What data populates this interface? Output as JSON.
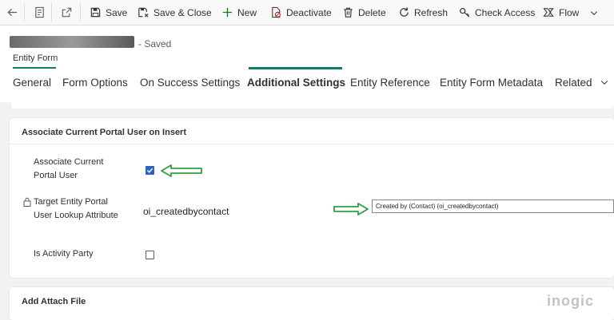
{
  "toolbar": {
    "save": "Save",
    "save_close": "Save & Close",
    "new": "New",
    "deactivate": "Deactivate",
    "delete": "Delete",
    "refresh": "Refresh",
    "check_access": "Check Access",
    "flow": "Flow"
  },
  "header": {
    "status": "- Saved",
    "entity_type": "Entity Form"
  },
  "tabs": [
    {
      "label": "General"
    },
    {
      "label": "Form Options"
    },
    {
      "label": "On Success Settings"
    },
    {
      "label": "Additional Settings"
    },
    {
      "label": "Entity Reference"
    },
    {
      "label": "Entity Form Metadata"
    },
    {
      "label": "Related"
    }
  ],
  "active_tab": "Additional Settings",
  "section1": {
    "title": "Associate Current Portal User on Insert",
    "fields": {
      "associate_label_1": "Associate Current",
      "associate_label_2": "Portal User",
      "associate_checked": true,
      "target_label_1": "Target Entity Portal",
      "target_label_2": "User Lookup Attribute",
      "target_value": "oi_createdbycontact",
      "target_lookup": "Created by (Contact) (oi_createdbycontact)",
      "activity_label": "Is Activity Party",
      "activity_checked": false
    }
  },
  "section2": {
    "title": "Add Attach File"
  },
  "watermark": "inogic",
  "colors": {
    "accent": "#0f7b6c",
    "arrow": "#2ea043",
    "checkbox": "#2b63c8"
  }
}
